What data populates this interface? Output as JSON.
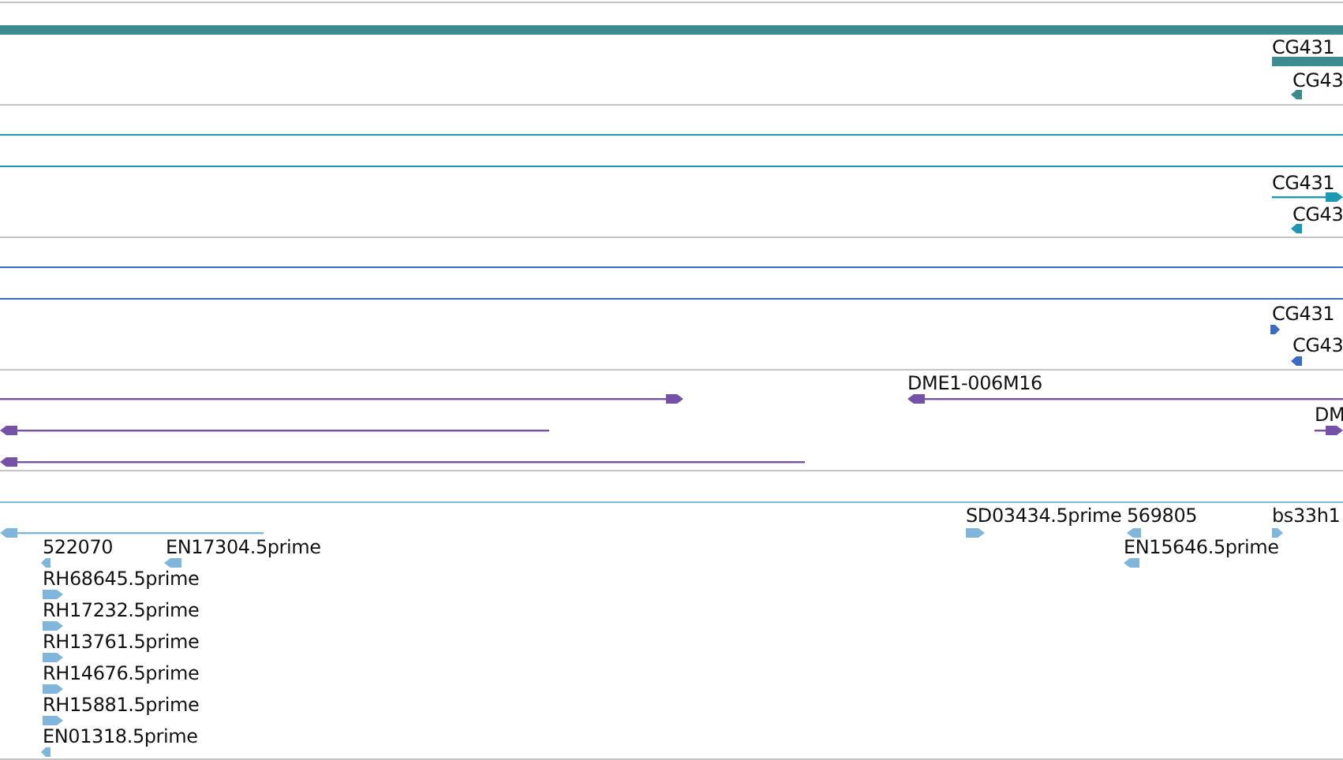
{
  "tracks": [
    {
      "color": "#3d8a8f",
      "features": [
        {
          "kind": "bar"
        },
        {
          "kind": "bar",
          "label": "CG431"
        },
        {
          "kind": "arrow",
          "reverse": true,
          "label": "CG43"
        }
      ]
    },
    {
      "color": "#1a98b4",
      "features": [
        {
          "kind": "span"
        },
        {
          "kind": "span"
        },
        {
          "kind": "line",
          "reverse": false,
          "label": "CG431"
        },
        {
          "kind": "arrow",
          "reverse": true,
          "label": "CG43"
        }
      ]
    },
    {
      "color": "#3a6cc6",
      "features": [
        {
          "kind": "span"
        },
        {
          "kind": "span"
        },
        {
          "kind": "arrow",
          "reverse": false,
          "label": "CG431"
        },
        {
          "kind": "arrow",
          "reverse": true,
          "label": "CG43"
        }
      ]
    },
    {
      "color": "#7452a8",
      "features": [
        {
          "kind": "line",
          "reverse": false
        },
        {
          "kind": "line",
          "reverse": true,
          "label": "DME1-006M16"
        },
        {
          "kind": "line",
          "reverse": true
        },
        {
          "kind": "line",
          "reverse": false,
          "label": "DM"
        },
        {
          "kind": "line",
          "reverse": true
        }
      ]
    },
    {
      "color": "#80b6dc",
      "features": [
        {
          "kind": "span"
        },
        {
          "kind": "line",
          "reverse": true
        },
        {
          "kind": "arrow",
          "reverse": true,
          "label": "522070"
        },
        {
          "kind": "arrow",
          "reverse": true,
          "label": "EN17304.5prime"
        },
        {
          "kind": "arrow",
          "reverse": false,
          "label": "RH68645.5prime"
        },
        {
          "kind": "arrow",
          "reverse": false,
          "label": "RH17232.5prime"
        },
        {
          "kind": "arrow",
          "reverse": false,
          "label": "RH13761.5prime"
        },
        {
          "kind": "arrow",
          "reverse": false,
          "label": "RH14676.5prime"
        },
        {
          "kind": "arrow",
          "reverse": false,
          "label": "RH15881.5prime"
        },
        {
          "kind": "arrow",
          "reverse": true,
          "label": "EN01318.5prime"
        },
        {
          "kind": "arrow",
          "reverse": false,
          "label": "SD03434.5prime"
        },
        {
          "kind": "arrow",
          "reverse": true,
          "label": "569805"
        },
        {
          "kind": "arrow",
          "reverse": true,
          "label": "EN15646.5prime"
        },
        {
          "kind": "arrow",
          "reverse": false,
          "label": "bs33h1"
        }
      ]
    }
  ]
}
